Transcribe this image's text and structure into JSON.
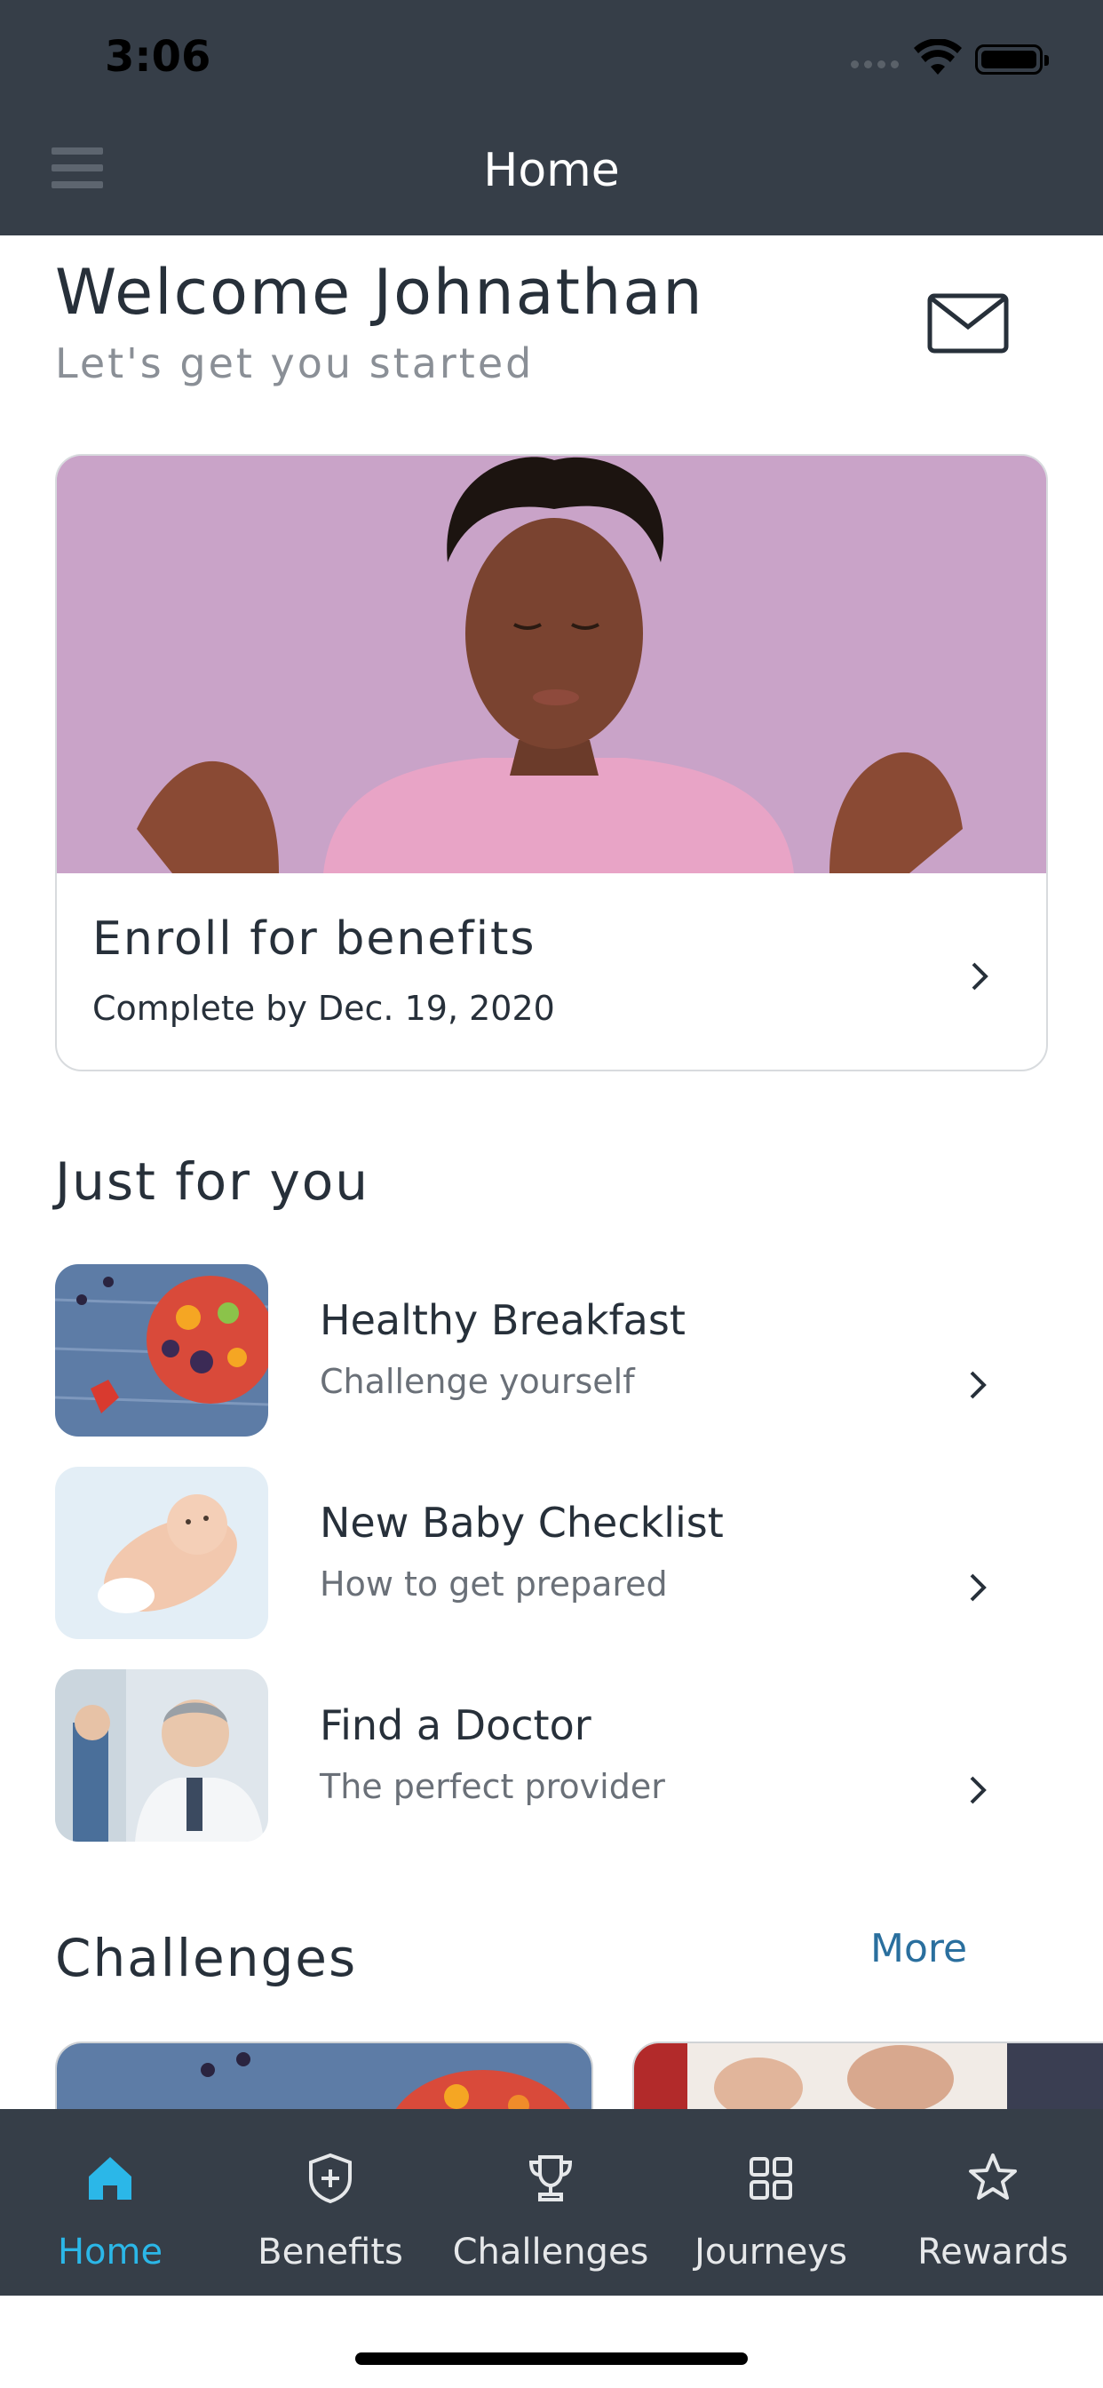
{
  "status_bar": {
    "time": "3:06"
  },
  "header": {
    "title": "Home"
  },
  "welcome": {
    "title": "Welcome Johnathan",
    "subtitle": "Let's get you started"
  },
  "enroll_card": {
    "title": "Enroll for benefits",
    "subtitle": "Complete by Dec. 19, 2020"
  },
  "just_for_you": {
    "heading": "Just for you",
    "items": [
      {
        "title": "Healthy Breakfast",
        "subtitle": "Challenge yourself"
      },
      {
        "title": "New Baby Checklist",
        "subtitle": "How to get prepared"
      },
      {
        "title": "Find a Doctor",
        "subtitle": "The perfect provider"
      }
    ]
  },
  "challenges": {
    "heading": "Challenges",
    "more_label": "More"
  },
  "bottom_nav": {
    "items": [
      {
        "label": "Home",
        "icon": "home-icon",
        "active": true
      },
      {
        "label": "Benefits",
        "icon": "shield-plus-icon",
        "active": false
      },
      {
        "label": "Challenges",
        "icon": "trophy-icon",
        "active": false
      },
      {
        "label": "Journeys",
        "icon": "grid-icon",
        "active": false
      },
      {
        "label": "Rewards",
        "icon": "star-icon",
        "active": false
      }
    ]
  },
  "colors": {
    "header_bg": "#363e48",
    "accent": "#2bb7e8",
    "link": "#2a6f9e",
    "text": "#27303a"
  }
}
